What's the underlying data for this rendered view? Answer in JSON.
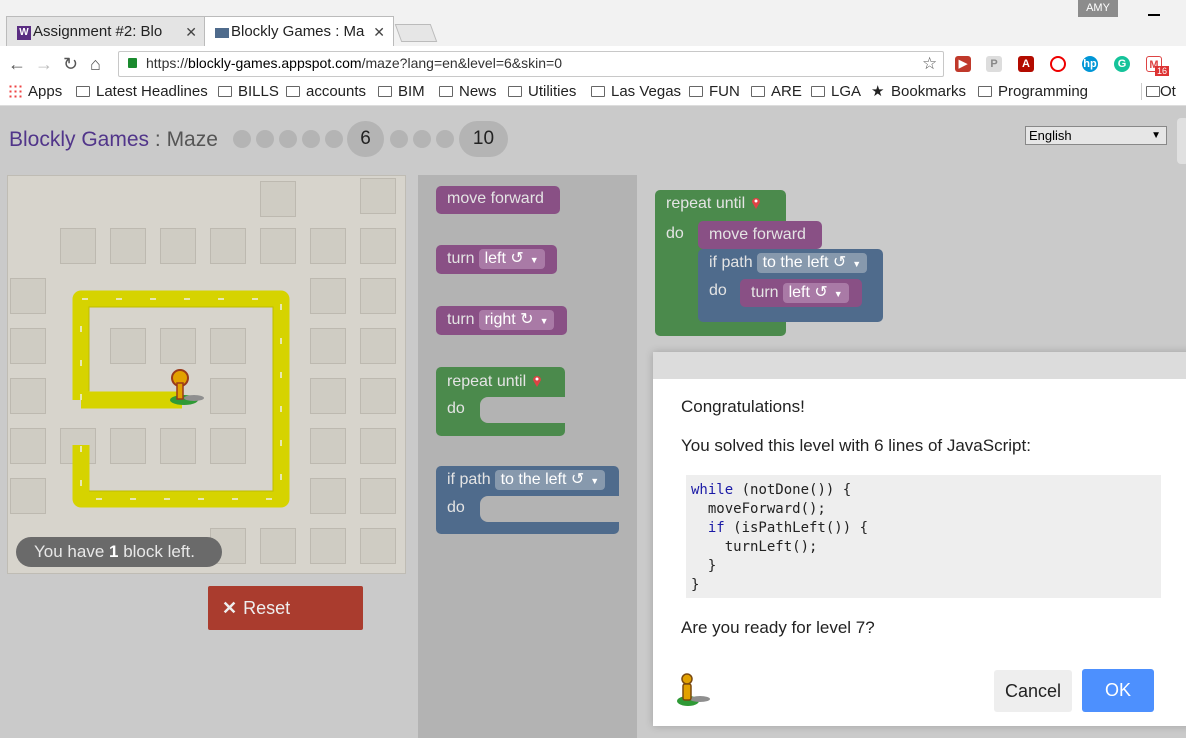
{
  "browser": {
    "tabs": [
      {
        "title": "Assignment #2: Blo",
        "favicon": "w-icon"
      },
      {
        "title": "Blockly Games : Ma",
        "favicon": "puzzle-icon"
      }
    ],
    "close_glyph": "✕",
    "user": "AMY",
    "url_prefix": "https://",
    "url_host": "blockly-games.appspot.com",
    "url_path": "/maze?lang=en&level=6&skin=0",
    "bookmarks": [
      "Apps",
      "Latest Headlines",
      "BILLS",
      "accounts",
      "BIM",
      "News",
      "Utilities",
      "Las Vegas",
      "FUN",
      "ARE",
      "LGA",
      "Bookmarks",
      "Programming",
      "Ot"
    ],
    "ext_badge": "16"
  },
  "header": {
    "app": "Blockly Games",
    "sep": " : ",
    "page": "Maze",
    "current_level": "6",
    "max_level": "10",
    "language": "English"
  },
  "maze": {
    "toast_prefix": "You have ",
    "toast_count": "1",
    "toast_suffix": " block left.",
    "reset_label": "Reset"
  },
  "toolbox": {
    "move_forward": "move forward",
    "turn": "turn",
    "left": "left ↺",
    "right": "right ↻",
    "repeat_until": "repeat until",
    "do": "do",
    "if_path": "if path",
    "to_the_left": "to the left ↺"
  },
  "dialog": {
    "congrats": "Congratulations!",
    "solved": "You solved this level with 6 lines of JavaScript:",
    "code": [
      "while",
      " (notDone()) {",
      "  moveForward();",
      "  ",
      "if",
      " (isPathLeft()) {",
      "    turnLeft();",
      "  }",
      "}"
    ],
    "ready": "Are you ready for level 7?",
    "cancel": "Cancel",
    "ok": "OK"
  },
  "colors": {
    "accent": "#4d90fe",
    "reset": "#aa3c2e",
    "purple_block": "#895085",
    "green_block": "#4b8a4c",
    "blue_block": "#4f6b8c",
    "path": "#d6d300"
  }
}
